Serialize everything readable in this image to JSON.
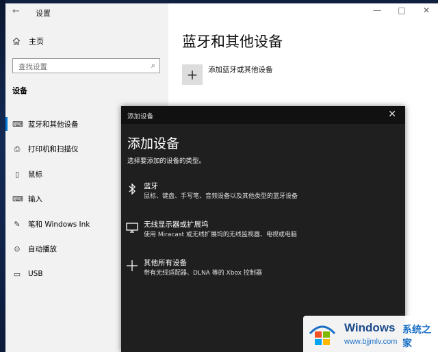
{
  "window": {
    "title": "设置",
    "back_icon": "back-arrow-icon",
    "controls": [
      "—",
      "□",
      "✕"
    ]
  },
  "sidebar": {
    "home_label": "主页",
    "search_placeholder": "查找设置",
    "section_title": "设备",
    "items": [
      {
        "label": "蓝牙和其他设备",
        "icon": "bluetooth-devices-icon",
        "active": true
      },
      {
        "label": "打印机和扫描仪",
        "icon": "printer-icon"
      },
      {
        "label": "鼠标",
        "icon": "mouse-icon"
      },
      {
        "label": "输入",
        "icon": "keyboard-icon"
      },
      {
        "label": "笔和 Windows Ink",
        "icon": "pen-icon"
      },
      {
        "label": "自动播放",
        "icon": "autoplay-icon"
      },
      {
        "label": "USB",
        "icon": "usb-icon"
      }
    ]
  },
  "main": {
    "title": "蓝牙和其他设备",
    "add_label": "添加蓝牙或其他设备"
  },
  "dialog": {
    "bar_title": "添加设备",
    "heading": "添加设备",
    "subtitle": "选择要添加的设备的类型。",
    "options": [
      {
        "title": "蓝牙",
        "desc": "鼠标、键盘、手写笔、音频设备以及其他类型的蓝牙设备",
        "icon": "bluetooth-icon"
      },
      {
        "title": "无线显示器或扩展坞",
        "desc": "使用 Miracast 或无线扩展坞的无线监视器、电视或电脑",
        "icon": "monitor-icon"
      },
      {
        "title": "其他所有设备",
        "desc": "带有无线适配器、DLNA 等的 Xbox 控制器",
        "icon": "plus-icon"
      }
    ]
  },
  "watermark": {
    "brand": "Windows",
    "brand_cn": "系统之家",
    "url": "www.bjjmlv.com"
  }
}
